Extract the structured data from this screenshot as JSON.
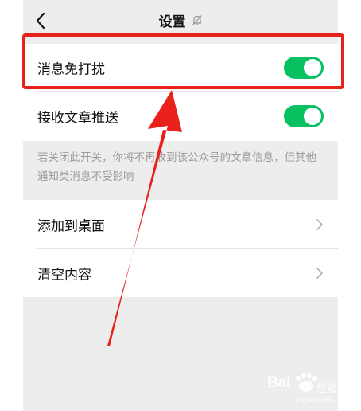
{
  "navbar": {
    "title": "设置"
  },
  "settings": {
    "mute_label": "消息免打扰",
    "mute_on": true,
    "articles_label": "接收文章推送",
    "articles_on": true,
    "hint": "若关闭此开关，你将不再收到该公众号的文章信息，但其他通知类消息不受影响",
    "add_to_desktop_label": "添加到桌面",
    "clear_content_label": "清空内容"
  },
  "watermark": {
    "brand": "Bai",
    "brand_suffix": "经验",
    "url": "jingyan.baidu.com"
  },
  "colors": {
    "toggle_on": "#07c160",
    "annotation_red": "#e8221b",
    "background": "#ededed"
  },
  "icons": {
    "back": "chevron-left-icon",
    "mute": "bell-off-icon",
    "row_arrow": "chevron-right-icon"
  }
}
